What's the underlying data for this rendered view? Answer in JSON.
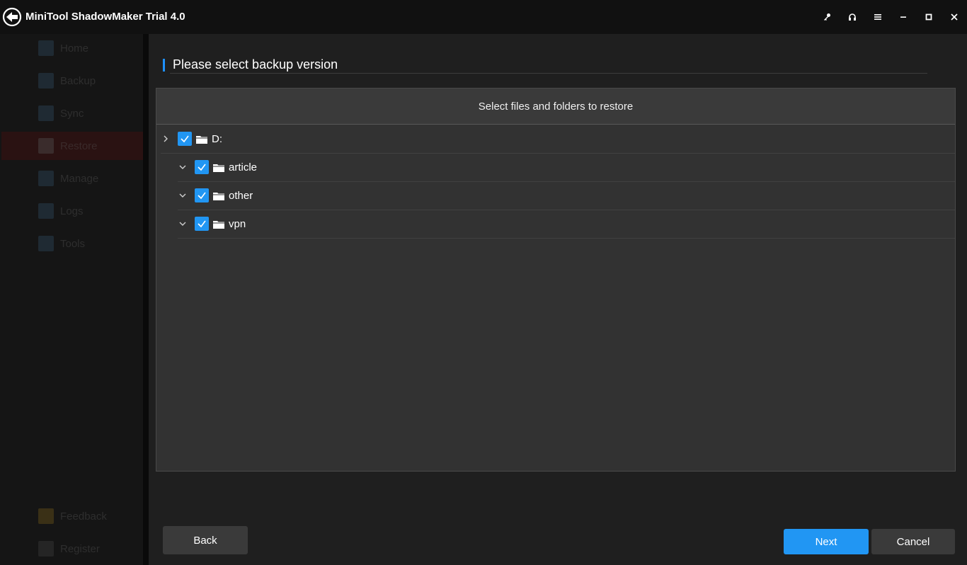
{
  "window": {
    "title": "MiniTool ShadowMaker Trial 4.0",
    "controls": [
      "key-icon",
      "headset-icon",
      "menu-icon",
      "minimize-icon",
      "maximize-icon",
      "close-icon"
    ]
  },
  "sidebar": {
    "items": [
      {
        "label": "Home",
        "icon": "home-icon"
      },
      {
        "label": "Backup",
        "icon": "backup-icon"
      },
      {
        "label": "Sync",
        "icon": "sync-icon"
      },
      {
        "label": "Restore",
        "icon": "restore-icon",
        "active": true
      },
      {
        "label": "Manage",
        "icon": "manage-icon"
      },
      {
        "label": "Logs",
        "icon": "logs-icon"
      },
      {
        "label": "Tools",
        "icon": "tools-icon"
      }
    ],
    "bottom": [
      {
        "label": "Feedback",
        "icon": "feedback-icon"
      },
      {
        "label": "Register",
        "icon": "lock-icon"
      }
    ]
  },
  "main": {
    "section_title": "Please select backup version",
    "panel_header": "Select files and folders to restore",
    "tree": [
      {
        "label": "D:",
        "checked": true,
        "expand": "collapsed"
      },
      {
        "label": "article",
        "checked": true,
        "expand": "expanded"
      },
      {
        "label": "other",
        "checked": true,
        "expand": "expanded"
      },
      {
        "label": "vpn",
        "checked": true,
        "expand": "expanded"
      }
    ]
  },
  "buttons": {
    "back": "Back",
    "next": "Next",
    "cancel": "Cancel"
  },
  "colors": {
    "accent": "#2196f3",
    "background": "#1f1f1f",
    "titlebar": "#111111"
  }
}
